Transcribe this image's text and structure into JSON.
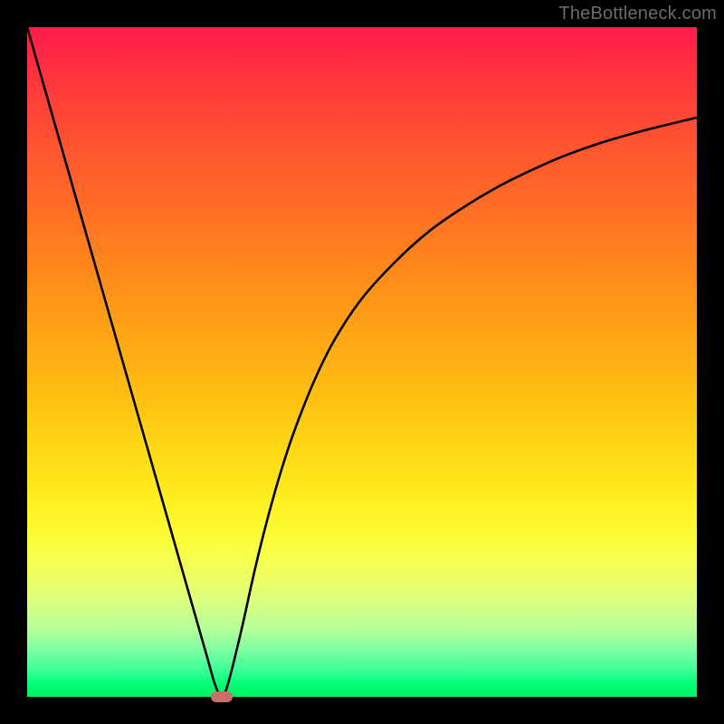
{
  "watermark": "TheBottleneck.com",
  "chart_data": {
    "type": "line",
    "title": "",
    "xlabel": "",
    "ylabel": "",
    "xlim": [
      0,
      100
    ],
    "ylim": [
      0,
      100
    ],
    "grid": false,
    "legend": false,
    "series": [
      {
        "name": "curve",
        "x": [
          0,
          3,
          6,
          9,
          12,
          15,
          18,
          21,
          24,
          27,
          28,
          29,
          30,
          32,
          34,
          36,
          38,
          40,
          43,
          46,
          50,
          55,
          60,
          65,
          70,
          75,
          80,
          85,
          90,
          95,
          100
        ],
        "y": [
          100,
          89.5,
          79,
          68.5,
          58,
          47.5,
          37,
          26.5,
          16,
          5.5,
          2,
          0,
          2,
          10,
          19,
          27,
          34,
          40,
          47.5,
          53.5,
          59.5,
          65,
          69.5,
          73,
          76,
          78.5,
          80.7,
          82.5,
          84,
          85.3,
          86.5
        ]
      }
    ],
    "annotations": [
      {
        "name": "min-marker",
        "x": 29,
        "y": 0,
        "shape": "pill",
        "color": "#cc6e66"
      }
    ],
    "background_gradient": {
      "direction": "vertical",
      "stops": [
        {
          "pos": 0.0,
          "color": "#ff1a4b"
        },
        {
          "pos": 0.5,
          "color": "#ffbf12"
        },
        {
          "pos": 0.8,
          "color": "#f0ff60"
        },
        {
          "pos": 1.0,
          "color": "#00f060"
        }
      ]
    }
  }
}
